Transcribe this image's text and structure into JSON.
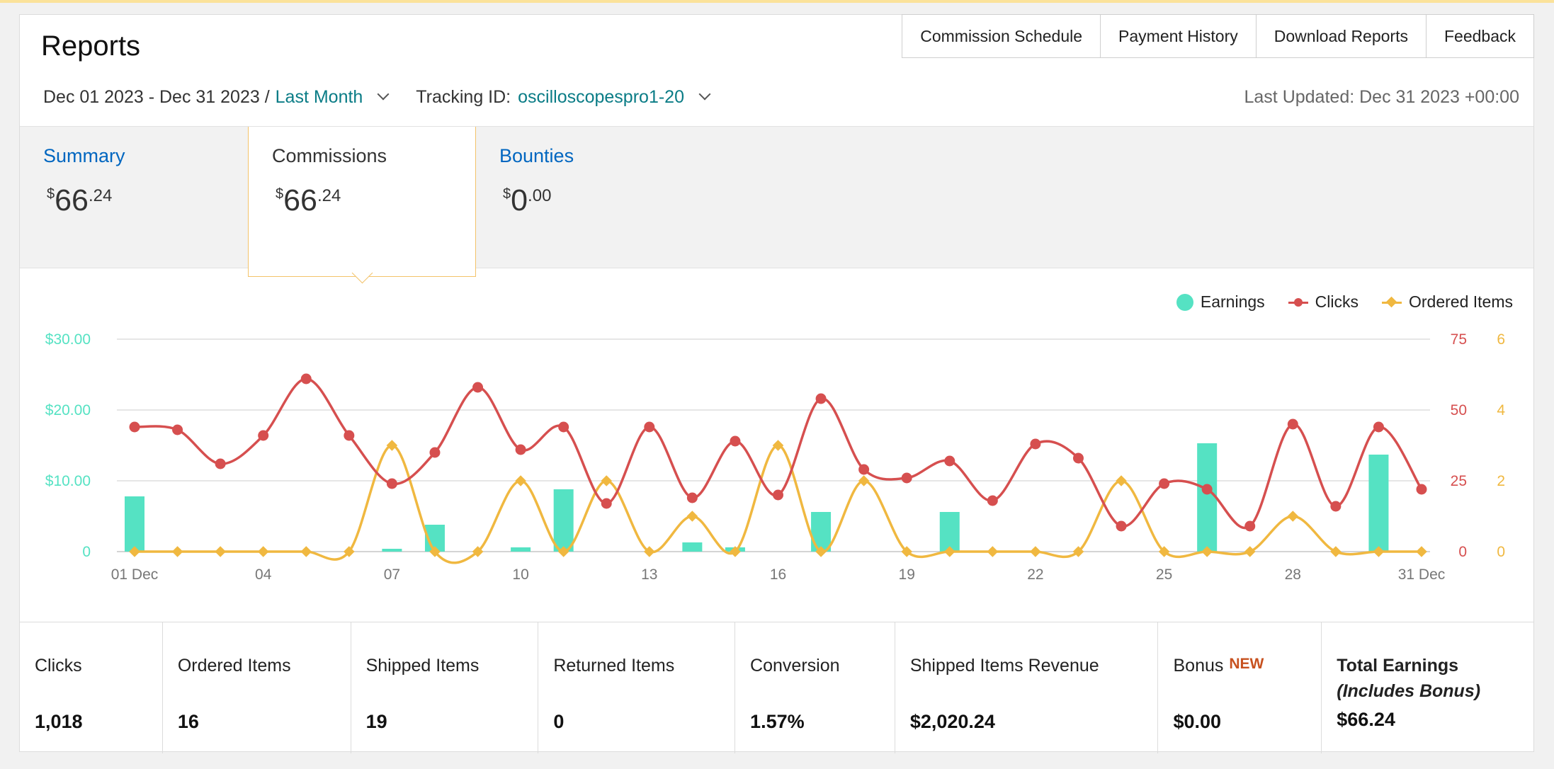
{
  "header": {
    "title": "Reports",
    "nav": [
      "Commission Schedule",
      "Payment History",
      "Download Reports",
      "Feedback"
    ],
    "date_range": "Dec 01 2023 - Dec 31 2023 /",
    "date_preset": "Last Month",
    "tracking_label": "Tracking ID:",
    "tracking_id": "oscilloscopespro1-20",
    "last_updated": "Last Updated: Dec 31 2023 +00:00"
  },
  "tabs": [
    {
      "label": "Summary",
      "currency": "$",
      "whole": "66",
      "cents": ".24"
    },
    {
      "label": "Commissions",
      "currency": "$",
      "whole": "66",
      "cents": ".24"
    },
    {
      "label": "Bounties",
      "currency": "$",
      "whole": "0",
      "cents": ".00"
    }
  ],
  "colors": {
    "earnings": "#55e2c3",
    "clicks": "#d64f4f",
    "ordered": "#f0b840",
    "link": "#0a7c86",
    "tab_link": "#0066c0",
    "accent_border": "#f3c36a"
  },
  "legend": {
    "earnings": "Earnings",
    "clicks": "Clicks",
    "ordered": "Ordered Items"
  },
  "chart_data": {
    "type": "bar+line",
    "x_tick_labels": [
      "01 Dec",
      "04",
      "07",
      "10",
      "13",
      "16",
      "19",
      "22",
      "25",
      "28",
      "31 Dec"
    ],
    "days": [
      1,
      2,
      3,
      4,
      5,
      6,
      7,
      8,
      9,
      10,
      11,
      12,
      13,
      14,
      15,
      16,
      17,
      18,
      19,
      20,
      21,
      22,
      23,
      24,
      25,
      26,
      27,
      28,
      29,
      30,
      31
    ],
    "y_left": {
      "ticks": [
        "0",
        "$10.00",
        "$20.00",
        "$30.00"
      ],
      "range": [
        0,
        30
      ]
    },
    "y_right_clicks": {
      "ticks": [
        "0",
        "25",
        "50",
        "75"
      ],
      "range": [
        0,
        75
      ]
    },
    "y_right_ordered": {
      "ticks": [
        "0",
        "2",
        "4",
        "6"
      ],
      "range": [
        0,
        6
      ]
    },
    "series": [
      {
        "name": "Earnings",
        "type": "bar",
        "values": [
          7.8,
          0,
          0,
          0,
          0,
          0,
          0.4,
          3.8,
          0,
          0.6,
          8.8,
          0,
          0,
          1.3,
          0.6,
          0,
          5.6,
          0,
          0,
          5.6,
          0,
          0,
          0,
          0,
          0,
          15.3,
          0,
          0,
          0,
          13.7,
          0
        ]
      },
      {
        "name": "Clicks",
        "type": "line",
        "values": [
          44,
          43,
          31,
          41,
          61,
          41,
          24,
          35,
          58,
          36,
          44,
          17,
          44,
          19,
          39,
          20,
          54,
          29,
          26,
          32,
          18,
          38,
          33,
          9,
          24,
          22,
          9,
          45,
          16,
          44,
          22
        ]
      },
      {
        "name": "Ordered Items",
        "type": "line",
        "values": [
          0,
          0,
          0,
          0,
          0,
          0,
          3,
          0,
          0,
          2,
          0,
          2,
          0,
          1,
          0,
          3,
          0,
          2,
          0,
          0,
          0,
          0,
          0,
          2,
          0,
          0,
          0,
          1,
          0,
          0,
          0
        ]
      }
    ]
  },
  "stats": [
    {
      "label": "Clicks",
      "value": "1,018"
    },
    {
      "label": "Ordered Items",
      "value": "16"
    },
    {
      "label": "Shipped Items",
      "value": "19"
    },
    {
      "label": "Returned Items",
      "value": "0"
    },
    {
      "label": "Conversion",
      "value": "1.57%"
    },
    {
      "label": "Shipped Items Revenue",
      "value": "$2,020.24"
    },
    {
      "label": "Bonus",
      "badge": "NEW",
      "value": "$0.00"
    },
    {
      "label": "Total Earnings",
      "sub": "(Includes Bonus)",
      "value": "$66.24"
    }
  ]
}
